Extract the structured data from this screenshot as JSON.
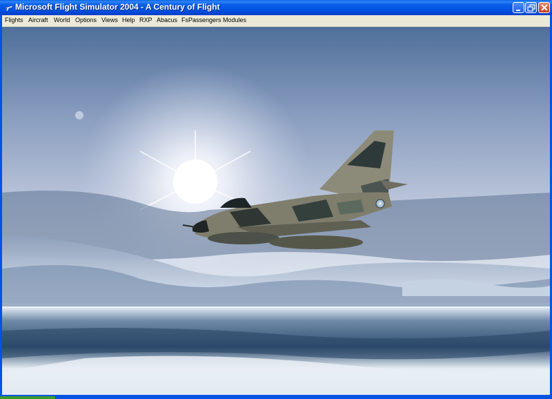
{
  "window": {
    "title": "Microsoft Flight Simulator 2004 - A Century of Flight",
    "icon": "airplane-icon",
    "controls": [
      "minimize-icon",
      "maximize-icon",
      "close-icon"
    ]
  },
  "menu": {
    "items": [
      "Flights",
      "Aircraft",
      "World",
      "Options",
      "Views",
      "Help",
      "RXP",
      "Abacus",
      "FsPassengers",
      "Modules"
    ]
  },
  "scene": {
    "description_colors": {
      "sky_top": "#4f6f9a",
      "sky_mid": "#a4b3cf",
      "sun_glow": "#ffffff",
      "water_dark": "#2f4f72",
      "water_light": "#dfe8f0"
    }
  },
  "colors": {
    "titlebar": "#0a5fe9",
    "menubar": "#ece9d8",
    "frame": "#0054e3"
  }
}
